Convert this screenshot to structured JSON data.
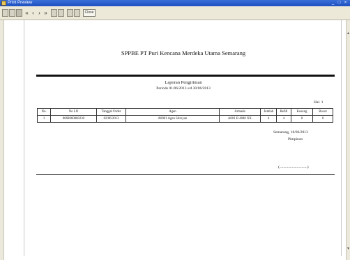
{
  "window": {
    "title": "Print Preview",
    "controls": [
      "_",
      "□",
      "×"
    ]
  },
  "toolbar": {
    "close_label": "Close"
  },
  "report": {
    "company": "SPPBE PT Puri Kencana Merdeka Utama Semarang",
    "title": "Laporan Pengiriman",
    "period": "Periode 01/06/2013 s/d 30/06/2013",
    "page_label": "Hal. 1",
    "columns": [
      "No.",
      "No LO",
      "Tanggal Order",
      "Agen",
      "Armada",
      "Jumlah",
      "Refill",
      "Kosong",
      "Bocor"
    ],
    "rows": [
      [
        "1",
        "8068060068230",
        "02/06/2013",
        "A0001 Agen Sitroyan",
        "A001 B 4840 XX",
        "4",
        "4",
        "0",
        "0"
      ]
    ],
    "signature": {
      "city_date": "Semarang, 18/06/2013",
      "role": "Pimpinan",
      "line": "(.............................)"
    }
  }
}
